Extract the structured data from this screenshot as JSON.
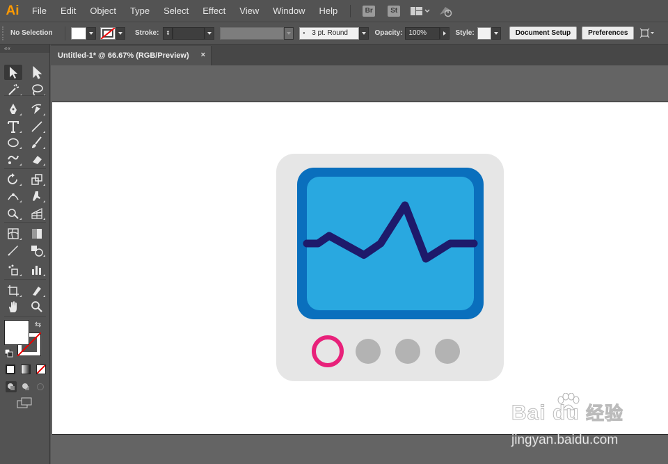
{
  "app": {
    "logo": "Ai",
    "accent": "#ff9a00"
  },
  "menu": {
    "items": [
      "File",
      "Edit",
      "Object",
      "Type",
      "Select",
      "Effect",
      "View",
      "Window",
      "Help"
    ],
    "bridge_badge": "Br",
    "stock_badge": "St",
    "workspace_icon": "workspace-switcher-icon",
    "gpu_icon": "gpu-performance-icon"
  },
  "control": {
    "selection_state": "No Selection",
    "stroke_label": "Stroke:",
    "brush_value": "3 pt. Round",
    "opacity_label": "Opacity:",
    "opacity_value": "100%",
    "style_label": "Style:",
    "document_setup": "Document Setup",
    "preferences": "Preferences"
  },
  "document": {
    "tab_title": "Untitled-1* @ 66.67% (RGB/Preview)",
    "close": "×"
  },
  "tools": [
    [
      "selection-tool",
      "direct-selection-tool"
    ],
    [
      "magic-wand-tool",
      "lasso-tool"
    ],
    [
      "pen-tool",
      "curvature-tool"
    ],
    [
      "type-tool",
      "line-segment-tool"
    ],
    [
      "ellipse-tool",
      "paintbrush-tool"
    ],
    [
      "shaper-tool",
      "eraser-tool"
    ],
    [
      "rotate-tool",
      "scale-tool"
    ],
    [
      "width-tool",
      "puppet-warp-tool"
    ],
    [
      "shape-builder-tool",
      "perspective-grid-tool"
    ],
    [
      "mesh-tool",
      "gradient-tool"
    ],
    [
      "eyedropper-tool",
      "blend-tool"
    ],
    [
      "symbol-sprayer-tool",
      "column-graph-tool"
    ],
    [
      "artboard-tool",
      "slice-tool"
    ],
    [
      "hand-tool",
      "zoom-tool"
    ]
  ],
  "artwork": {
    "frame_color": "#e6e6e6",
    "screen_border_color": "#0a6fbd",
    "screen_color": "#29a8e0",
    "pulse_color": "#1e1a6b",
    "button_active_color": "#e8217a",
    "button_inactive_color": "#b3b3b3",
    "pulse_values": [
      0,
      0,
      0.2,
      -0.3,
      0,
      1,
      -0.4,
      0,
      0
    ]
  },
  "watermark": {
    "brand": "Bai du",
    "brand_cn": "经验",
    "url": "jingyan.baidu.com"
  }
}
